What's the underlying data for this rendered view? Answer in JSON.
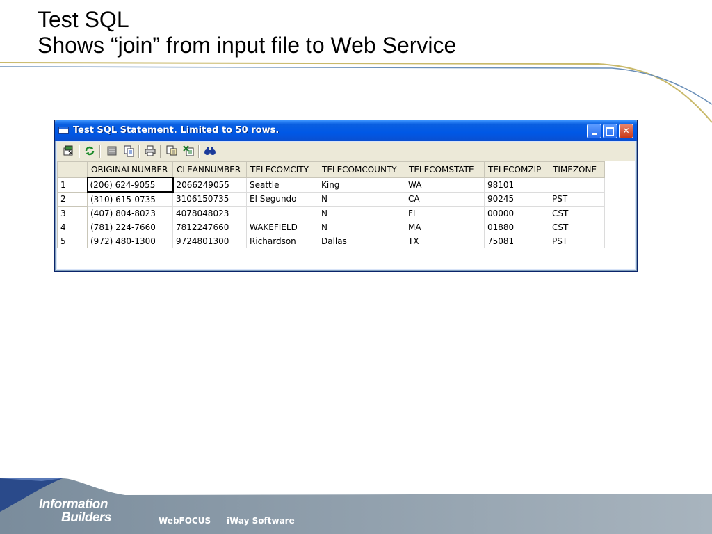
{
  "slide": {
    "title_line1": "Test SQL",
    "title_line2": "Shows “join” from input file to Web Service"
  },
  "window": {
    "title": "Test SQL Statement. Limited to 50 rows.",
    "controls": [
      "minimize-icon",
      "maximize-icon",
      "close-icon"
    ],
    "toolbar_icons": [
      "open-data-icon",
      "refresh-icon",
      "stop-icon",
      "copy-icon",
      "print-icon",
      "export-icon",
      "excel-export-icon",
      "find-icon"
    ]
  },
  "grid": {
    "columns": [
      "",
      "ORIGINALNUMBER",
      "CLEANNUMBER",
      "TELECOMCITY",
      "TELECOMCOUNTY",
      "TELECOMSTATE",
      "TELECOMZIP",
      "TIMEZONE"
    ],
    "rows": [
      [
        "1",
        "(206) 624-9055",
        "2066249055",
        "Seattle",
        "King",
        "WA",
        "98101",
        ""
      ],
      [
        "2",
        "(310) 615-0735",
        "3106150735",
        "El Segundo",
        "N",
        "CA",
        "90245",
        "PST"
      ],
      [
        "3",
        "(407) 804-8023",
        "4078048023",
        "",
        "N",
        "FL",
        "00000",
        "CST"
      ],
      [
        "4",
        "(781) 224-7660",
        "7812247660",
        "WAKEFIELD",
        "N",
        "MA",
        "01880",
        "CST"
      ],
      [
        "5",
        "(972) 480-1300",
        "9724801300",
        "Richardson",
        "Dallas",
        "TX",
        "75081",
        "PST"
      ]
    ]
  },
  "footer": {
    "logo_line1": "Information",
    "logo_line2": "Builders",
    "link1": "WebFOCUS",
    "link2": "iWay Software"
  },
  "colors": {
    "title_bar": "#0058e6",
    "footer_band": "#8a9aa8",
    "accent_line": "#c9b96a",
    "accent_blue": "#6a8fb8"
  }
}
